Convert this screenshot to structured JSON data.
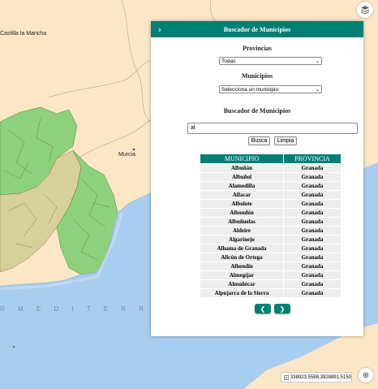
{
  "map": {
    "labels": {
      "region": "Castilla la Mancha",
      "city": "Murcia",
      "sea": "R  M E D I T E R R Á N E"
    },
    "colors": {
      "sea": "#a9cdee",
      "land": "#fbe7c6",
      "green": "#8ed17c",
      "yellow": "#d8d09a",
      "beige": "#f4ddb5"
    }
  },
  "layers_button": {
    "icon": "layers-icon"
  },
  "panel": {
    "title": "Buscador de Municipios",
    "toggle_icon": "chevron-right-icon",
    "provincias": {
      "label": "Provincias",
      "selected": "Todas"
    },
    "municipios": {
      "label": "Municipios",
      "selected": "Selecciona un municipio"
    },
    "search": {
      "label": "Buscador de Municipios",
      "value": "al",
      "search_button": "Busca",
      "clear_button": "Limpia"
    },
    "table": {
      "headers": [
        "MUNICIPIO",
        "PROVINCIA"
      ],
      "rows": [
        [
          "Albuñán",
          "Granada"
        ],
        [
          "Albuñol",
          "Granada"
        ],
        [
          "Alamedilla",
          "Granada"
        ],
        [
          "Alfacar",
          "Granada"
        ],
        [
          "Albolote",
          "Granada"
        ],
        [
          "Albondón",
          "Granada"
        ],
        [
          "Albuñuelas",
          "Granada"
        ],
        [
          "Aldeire",
          "Granada"
        ],
        [
          "Algarinejo",
          "Granada"
        ],
        [
          "Alhama de Granada",
          "Granada"
        ],
        [
          "Alicún de Ortega",
          "Granada"
        ],
        [
          "Alhendín",
          "Granada"
        ],
        [
          "Almegíjar",
          "Granada"
        ],
        [
          "Almuñécar",
          "Granada"
        ],
        [
          "Alpujarra de la Sierra",
          "Granada"
        ]
      ]
    },
    "pager": {
      "prev_icon": "arrow-left-icon",
      "next_icon": "arrow-right-icon"
    }
  },
  "coordinates": {
    "text": "338923.5588,3928891.5150",
    "icon": "location-icon"
  },
  "globe_button": {
    "icon": "globe-icon"
  },
  "accent": "#007f74"
}
